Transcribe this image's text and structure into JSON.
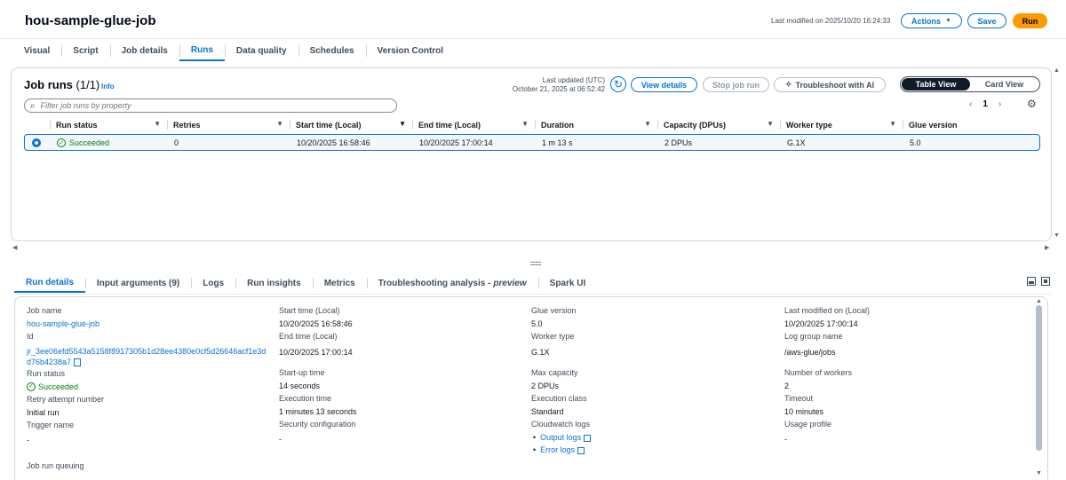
{
  "header": {
    "title": "hou-sample-glue-job",
    "last_modified": "Last modified on 2025/10/20 16:24:33",
    "actions_label": "Actions",
    "save_label": "Save",
    "run_label": "Run"
  },
  "tabs": [
    "Visual",
    "Script",
    "Job details",
    "Runs",
    "Data quality",
    "Schedules",
    "Version Control"
  ],
  "runs_panel": {
    "title": "Job runs",
    "count": "(1/1)",
    "info": "Info",
    "last_updated_label": "Last updated (UTC)",
    "last_updated_value": "October 21, 2025 at 06:52:42",
    "view_details": "View details",
    "stop_job_run": "Stop job run",
    "troubleshoot": "Troubleshoot with AI",
    "table_view": "Table View",
    "card_view": "Card View",
    "filter_placeholder": "Filter job runs by property",
    "page": "1",
    "columns": [
      "Run status",
      "Retries",
      "Start time (Local)",
      "End time (Local)",
      "Duration",
      "Capacity (DPUs)",
      "Worker type",
      "Glue version"
    ],
    "rows": [
      {
        "status": "Succeeded",
        "retries": "0",
        "start": "10/20/2025 16:58:46",
        "end": "10/20/2025 17:00:14",
        "duration": "1 m 13 s",
        "capacity": "2 DPUs",
        "worker": "G.1X",
        "glue": "5.0"
      }
    ]
  },
  "bottom_tabs": {
    "run_details": "Run details",
    "input_arguments": "Input arguments (9)",
    "logs": "Logs",
    "run_insights": "Run insights",
    "metrics": "Metrics",
    "troubleshooting": "Troubleshooting analysis -",
    "troubleshooting_tag": "preview",
    "spark_ui": "Spark UI"
  },
  "details": {
    "job_name_label": "Job name",
    "job_name": "hou-sample-glue-job",
    "id_label": "Id",
    "id_line1": "jr_3ee06efd5543a5158f8917305b1d28ee4380e0cf5d26646acf1e3d",
    "id_line2": "d76b4238a7",
    "run_status_label": "Run status",
    "run_status": "Succeeded",
    "retry_label": "Retry attempt number",
    "retry": "Initial run",
    "trigger_label": "Trigger name",
    "trigger": "-",
    "start_label": "Start time (Local)",
    "start": "10/20/2025 16:58:46",
    "end_label": "End time (Local)",
    "end": "10/20/2025 17:00:14",
    "startup_label": "Start-up time",
    "startup": "14 seconds",
    "exec_label": "Execution time",
    "exec": "1 minutes 13 seconds",
    "security_label": "Security configuration",
    "security": "-",
    "glue_label": "Glue version",
    "glue": "5.0",
    "worker_label": "Worker type",
    "worker": "G.1X",
    "capacity_label": "Max capacity",
    "capacity": "2 DPUs",
    "exec_class_label": "Execution class",
    "exec_class": "Standard",
    "cw_label": "Cloudwatch logs",
    "output_logs": "Output logs",
    "error_logs": "Error logs",
    "last_mod_label": "Last modified on (Local)",
    "last_mod": "10/20/2025 17:00:14",
    "log_group_label": "Log group name",
    "log_group": "/aws-glue/jobs",
    "workers_label": "Number of workers",
    "workers": "2",
    "timeout_label": "Timeout",
    "timeout": "10 minutes",
    "usage_label": "Usage profile",
    "usage": "-",
    "queuing_label": "Job run queuing"
  }
}
